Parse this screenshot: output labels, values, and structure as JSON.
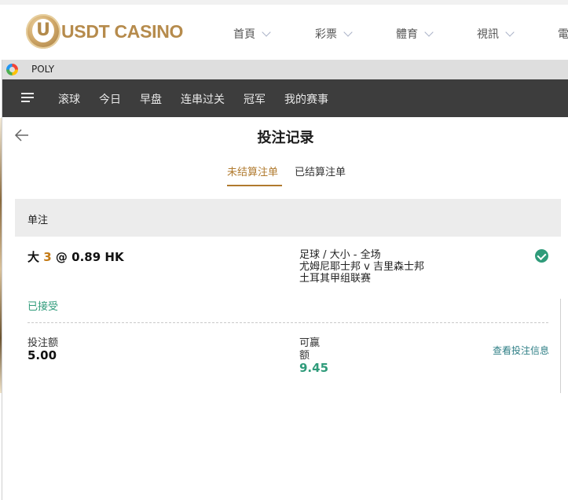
{
  "site": {
    "logo_text": "USDT CASINO",
    "logo_letter": "U",
    "nav": [
      "首頁",
      "彩票",
      "體育",
      "視訊",
      "電"
    ]
  },
  "window": {
    "title": "POLY",
    "menu": [
      "滚球",
      "今日",
      "早盘",
      "连串过关",
      "冠军",
      "我的赛事"
    ]
  },
  "page": {
    "title": "投注记录",
    "tabs": [
      "未结算注单",
      "已结算注单"
    ],
    "active_tab": "未结算注单"
  },
  "section": {
    "label": "单注"
  },
  "bet": {
    "selection": "大",
    "line": "3",
    "at": "@",
    "odds": "0.89 HK",
    "market": "足球 / 大小 - 全场",
    "match": "尤姆尼耶士邦 v 吉里森士邦",
    "league": "土耳其甲组联赛",
    "status": "已接受",
    "stake_label": "投注额",
    "stake_value": "5.00",
    "win_label_1": "可赢",
    "win_label_2": "额",
    "win_value": "9.45",
    "details_link": "查看投注信息"
  },
  "colors": {
    "accent_gold": "#b07a2e",
    "status_green": "#2f9b7a",
    "menubar_bg": "#3d3d3d"
  },
  "icons": [
    "menu-icon",
    "back-arrow-icon",
    "check-circle-icon",
    "chevron-down-icon",
    "app-icon"
  ]
}
